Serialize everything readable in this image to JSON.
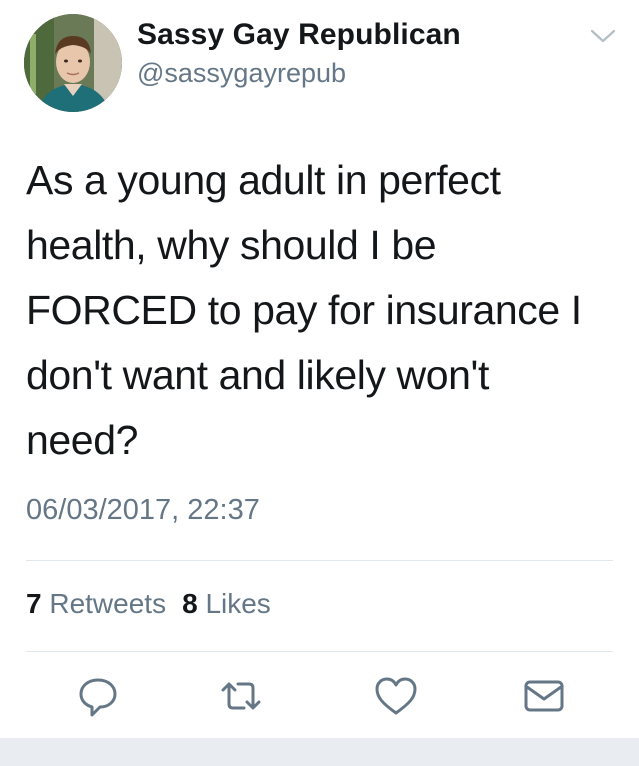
{
  "user": {
    "display_name": "Sassy Gay Republican",
    "handle": "@sassygayrepub",
    "avatar_icon": "profile-photo"
  },
  "tweet": {
    "lines": [
      "As a young adult in perfect",
      "health, why should I be",
      "FORCED to pay for insurance I",
      "don't want and likely won't",
      "need?"
    ],
    "timestamp": "06/03/2017, 22:37"
  },
  "stats": {
    "retweets_count": "7",
    "retweets_label": "Retweets",
    "likes_count": "8",
    "likes_label": "Likes"
  },
  "actions": {
    "icons": [
      "reply-icon",
      "retweet-icon",
      "like-icon",
      "message-icon"
    ]
  },
  "colors": {
    "text_primary": "#14171a",
    "text_secondary": "#657786",
    "divider": "#e1e8ed",
    "icon": "#657786"
  }
}
